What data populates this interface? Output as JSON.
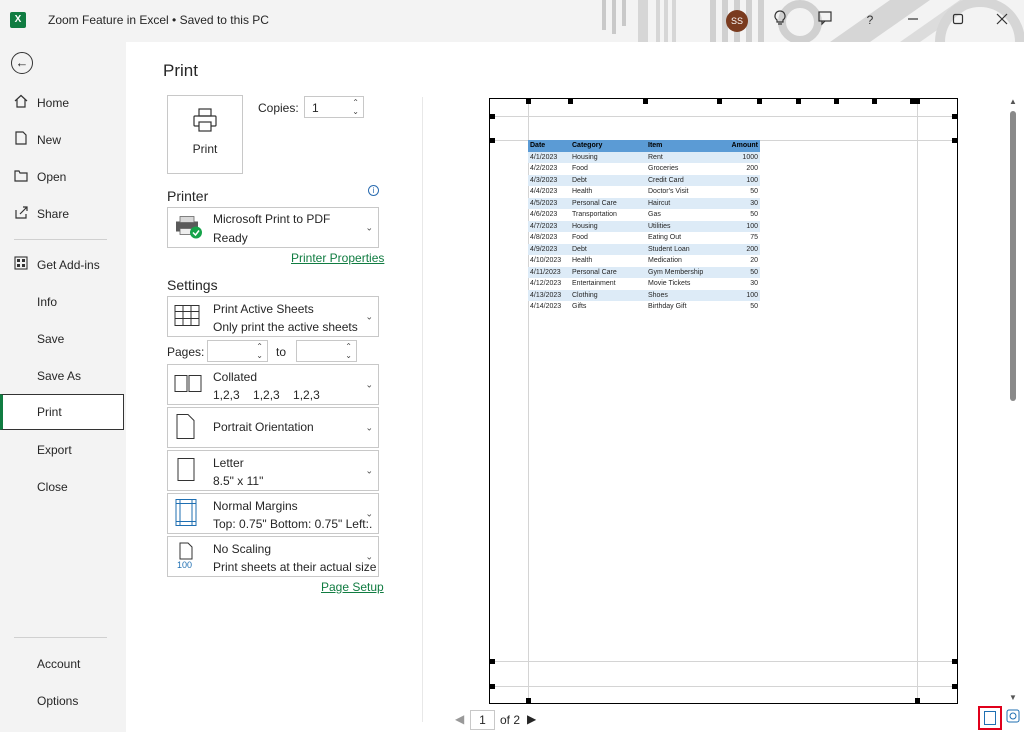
{
  "titlebar": {
    "app_letter": "X",
    "title": "Zoom Feature in Excel • Saved to this PC",
    "avatar_initials": "SS"
  },
  "nav": {
    "items": [
      {
        "label": "Home",
        "icon": "home-icon"
      },
      {
        "label": "New",
        "icon": "new-document-icon"
      },
      {
        "label": "Open",
        "icon": "folder-open-icon"
      },
      {
        "label": "Share",
        "icon": "share-icon"
      },
      {
        "label": "Get Add-ins",
        "icon": "add-ins-icon"
      },
      {
        "label": "Info"
      },
      {
        "label": "Save"
      },
      {
        "label": "Save As"
      },
      {
        "label": "Print",
        "active": true
      },
      {
        "label": "Export"
      },
      {
        "label": "Close"
      },
      {
        "label": "Account"
      },
      {
        "label": "Options"
      }
    ]
  },
  "print": {
    "heading": "Print",
    "button_label": "Print",
    "copies_label": "Copies:",
    "copies_value": "1"
  },
  "printer": {
    "section_title": "Printer",
    "name": "Microsoft Print to PDF",
    "status": "Ready",
    "properties_link": "Printer Properties"
  },
  "settings": {
    "section_title": "Settings",
    "sheets": {
      "title": "Print Active Sheets",
      "subtitle": "Only print the active sheets"
    },
    "pages_label": "Pages:",
    "to_label": "to",
    "collation": {
      "title": "Collated",
      "subtitle": "1,2,3    1,2,3    1,2,3"
    },
    "orientation": {
      "title": "Portrait Orientation"
    },
    "paper": {
      "title": "Letter",
      "subtitle": "8.5\" x 11\""
    },
    "margins": {
      "title": "Normal Margins",
      "subtitle": "Top: 0.75\" Bottom: 0.75\" Left:..."
    },
    "scaling": {
      "title": "No Scaling",
      "subtitle": "Print sheets at their actual size",
      "icon_text": "100"
    },
    "page_setup_link": "Page Setup"
  },
  "preview": {
    "columns": [
      "Date",
      "Category",
      "Item",
      "Amount"
    ],
    "rows": [
      [
        "4/1/2023",
        "Housing",
        "Rent",
        "1000"
      ],
      [
        "4/2/2023",
        "Food",
        "Groceries",
        "200"
      ],
      [
        "4/3/2023",
        "Debt",
        "Credit Card",
        "100"
      ],
      [
        "4/4/2023",
        "Health",
        "Doctor's Visit",
        "50"
      ],
      [
        "4/5/2023",
        "Personal Care",
        "Haircut",
        "30"
      ],
      [
        "4/6/2023",
        "Transportation",
        "Gas",
        "50"
      ],
      [
        "4/7/2023",
        "Housing",
        "Utilities",
        "100"
      ],
      [
        "4/8/2023",
        "Food",
        "Eating Out",
        "75"
      ],
      [
        "4/9/2023",
        "Debt",
        "Student Loan",
        "200"
      ],
      [
        "4/10/2023",
        "Health",
        "Medication",
        "20"
      ],
      [
        "4/11/2023",
        "Personal Care",
        "Gym Membership",
        "50"
      ],
      [
        "4/12/2023",
        "Entertainment",
        "Movie Tickets",
        "30"
      ],
      [
        "4/13/2023",
        "Clothing",
        "Shoes",
        "100"
      ],
      [
        "4/14/2023",
        "Gifts",
        "Birthday Gift",
        "50"
      ]
    ],
    "current_page": "1",
    "of_total": "of 2"
  },
  "colors": {
    "accent": "#107c41",
    "table_header": "#5b9bd5",
    "table_band": "#ddebf7",
    "highlight": "#e0001b"
  }
}
